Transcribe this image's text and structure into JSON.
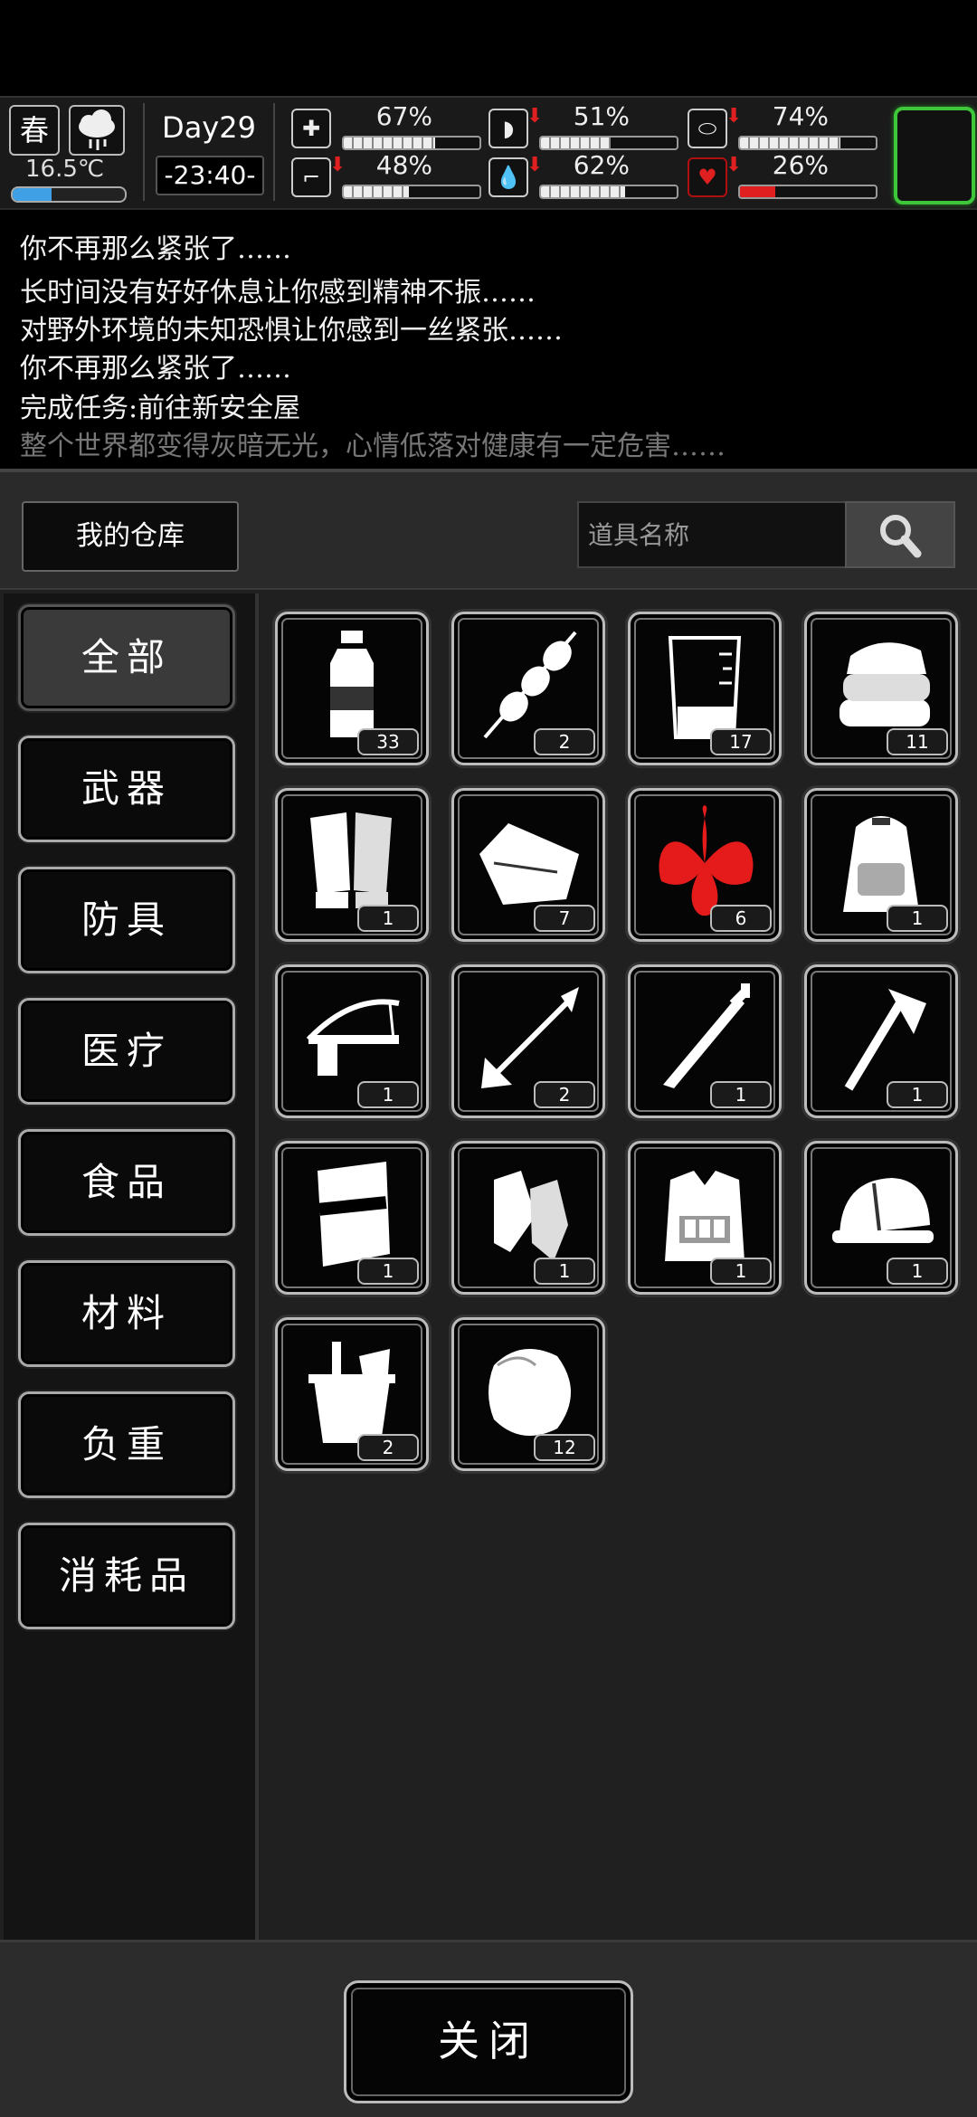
{
  "status": {
    "season": "春",
    "temperature": "16.5℃",
    "temperature_level": 0.35,
    "day": "Day29",
    "time": "-23:40-",
    "stats": [
      {
        "icon": "medkit-icon",
        "glyph": "✚",
        "pct": "67%",
        "value": 0.67,
        "down": false,
        "red": false
      },
      {
        "icon": "stomach-icon",
        "glyph": "◗",
        "pct": "51%",
        "value": 0.51,
        "down": true,
        "red": false
      },
      {
        "icon": "pill-icon",
        "glyph": "⬭",
        "pct": "74%",
        "value": 0.74,
        "down": true,
        "red": false
      },
      {
        "icon": "foot-icon",
        "glyph": "⌐",
        "pct": "48%",
        "value": 0.48,
        "down": true,
        "red": false
      },
      {
        "icon": "water-drop-icon",
        "glyph": "💧",
        "pct": "62%",
        "value": 0.62,
        "down": true,
        "red": false
      },
      {
        "icon": "heart-icon",
        "glyph": "♥",
        "pct": "26%",
        "value": 0.26,
        "down": true,
        "red": true
      }
    ]
  },
  "log": [
    "你不再那么紧张了……",
    "长时间没有好好休息让你感到精神不振……",
    "对野外环境的未知恐惧让你感到一丝紧张……",
    "你不再那么紧张了……",
    "完成任务:前往新安全屋",
    "整个世界都变得灰暗无光，心情低落对健康有一定危害……"
  ],
  "warehouse": {
    "title": "我的仓库",
    "search_placeholder": "道具名称"
  },
  "categories": [
    "全部",
    "武器",
    "防具",
    "医疗",
    "食品",
    "材料",
    "负重",
    "消耗品"
  ],
  "items": [
    {
      "name": "water-bottle",
      "count": "33"
    },
    {
      "name": "meat-skewer",
      "count": "2"
    },
    {
      "name": "beaker",
      "count": "17"
    },
    {
      "name": "cloth",
      "count": "11"
    },
    {
      "name": "gloves",
      "count": "1"
    },
    {
      "name": "raw-meat",
      "count": "7"
    },
    {
      "name": "herb",
      "count": "6"
    },
    {
      "name": "backpack",
      "count": "1"
    },
    {
      "name": "crossbow",
      "count": "1"
    },
    {
      "name": "arrow",
      "count": "2"
    },
    {
      "name": "sword",
      "count": "1"
    },
    {
      "name": "axe",
      "count": "1"
    },
    {
      "name": "riot-shield",
      "count": "1"
    },
    {
      "name": "leg-armor",
      "count": "1"
    },
    {
      "name": "tactical-vest",
      "count": "1"
    },
    {
      "name": "hard-hat",
      "count": "1"
    },
    {
      "name": "bucket",
      "count": "2"
    },
    {
      "name": "steak",
      "count": "12"
    }
  ],
  "close_label": "关闭"
}
